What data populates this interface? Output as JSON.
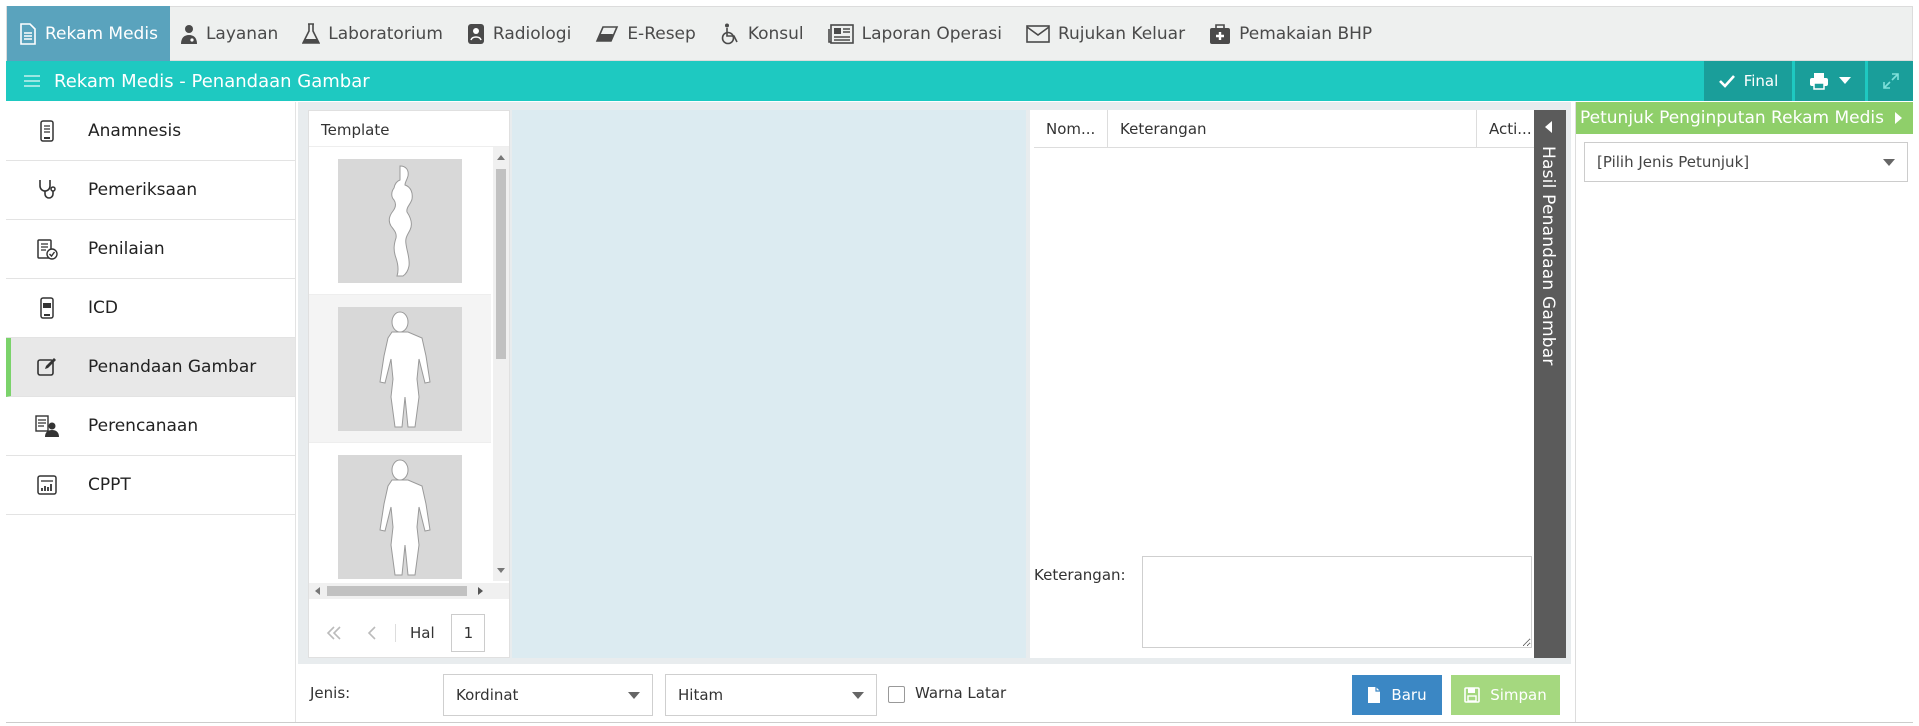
{
  "nav": {
    "items": [
      {
        "label": "Rekam Medis",
        "icon": "document-icon",
        "active": true
      },
      {
        "label": "Layanan",
        "icon": "doctor-icon"
      },
      {
        "label": "Laboratorium",
        "icon": "flask-icon"
      },
      {
        "label": "Radiologi",
        "icon": "radiology-icon"
      },
      {
        "label": "E-Resep",
        "icon": "pill-icon"
      },
      {
        "label": "Konsul",
        "icon": "wheelchair-icon"
      },
      {
        "label": "Laporan Operasi",
        "icon": "newspaper-icon"
      },
      {
        "label": "Rujukan Keluar",
        "icon": "envelope-icon"
      },
      {
        "label": "Pemakaian BHP",
        "icon": "medkit-icon"
      }
    ]
  },
  "titlebar": {
    "title": "Rekam Medis - Penandaan Gambar",
    "final_label": "Final",
    "accent": "#1ec9c1"
  },
  "sidebar": {
    "items": [
      {
        "label": "Anamnesis",
        "icon": "phone-clipboard-icon"
      },
      {
        "label": "Pemeriksaan",
        "icon": "stethoscope-icon"
      },
      {
        "label": "Penilaian",
        "icon": "checklist-icon"
      },
      {
        "label": "ICD",
        "icon": "icd-icon"
      },
      {
        "label": "Penandaan Gambar",
        "icon": "edit-icon",
        "active": true
      },
      {
        "label": "Perencanaan",
        "icon": "planning-icon"
      },
      {
        "label": "CPPT",
        "icon": "chart-icon"
      }
    ]
  },
  "template": {
    "header": "Template",
    "pager_label": "Hal",
    "page": "1"
  },
  "result": {
    "col_nomor": "Nom...",
    "col_keterangan": "Keterangan",
    "col_action": "Acti...",
    "keterangan_label": "Keterangan:",
    "tab_label": "Hasil Penandaan Gambar"
  },
  "bottom": {
    "jenis_label": "Jenis:",
    "jenis_value": "Kordinat",
    "warna_value": "Hitam",
    "warna_latar_label": "Warna Latar",
    "baru_label": "Baru",
    "simpan_label": "Simpan"
  },
  "petunjuk": {
    "title": "Petunjuk Penginputan Rekam Medis",
    "select_placeholder": "[Pilih Jenis Petunjuk]"
  }
}
